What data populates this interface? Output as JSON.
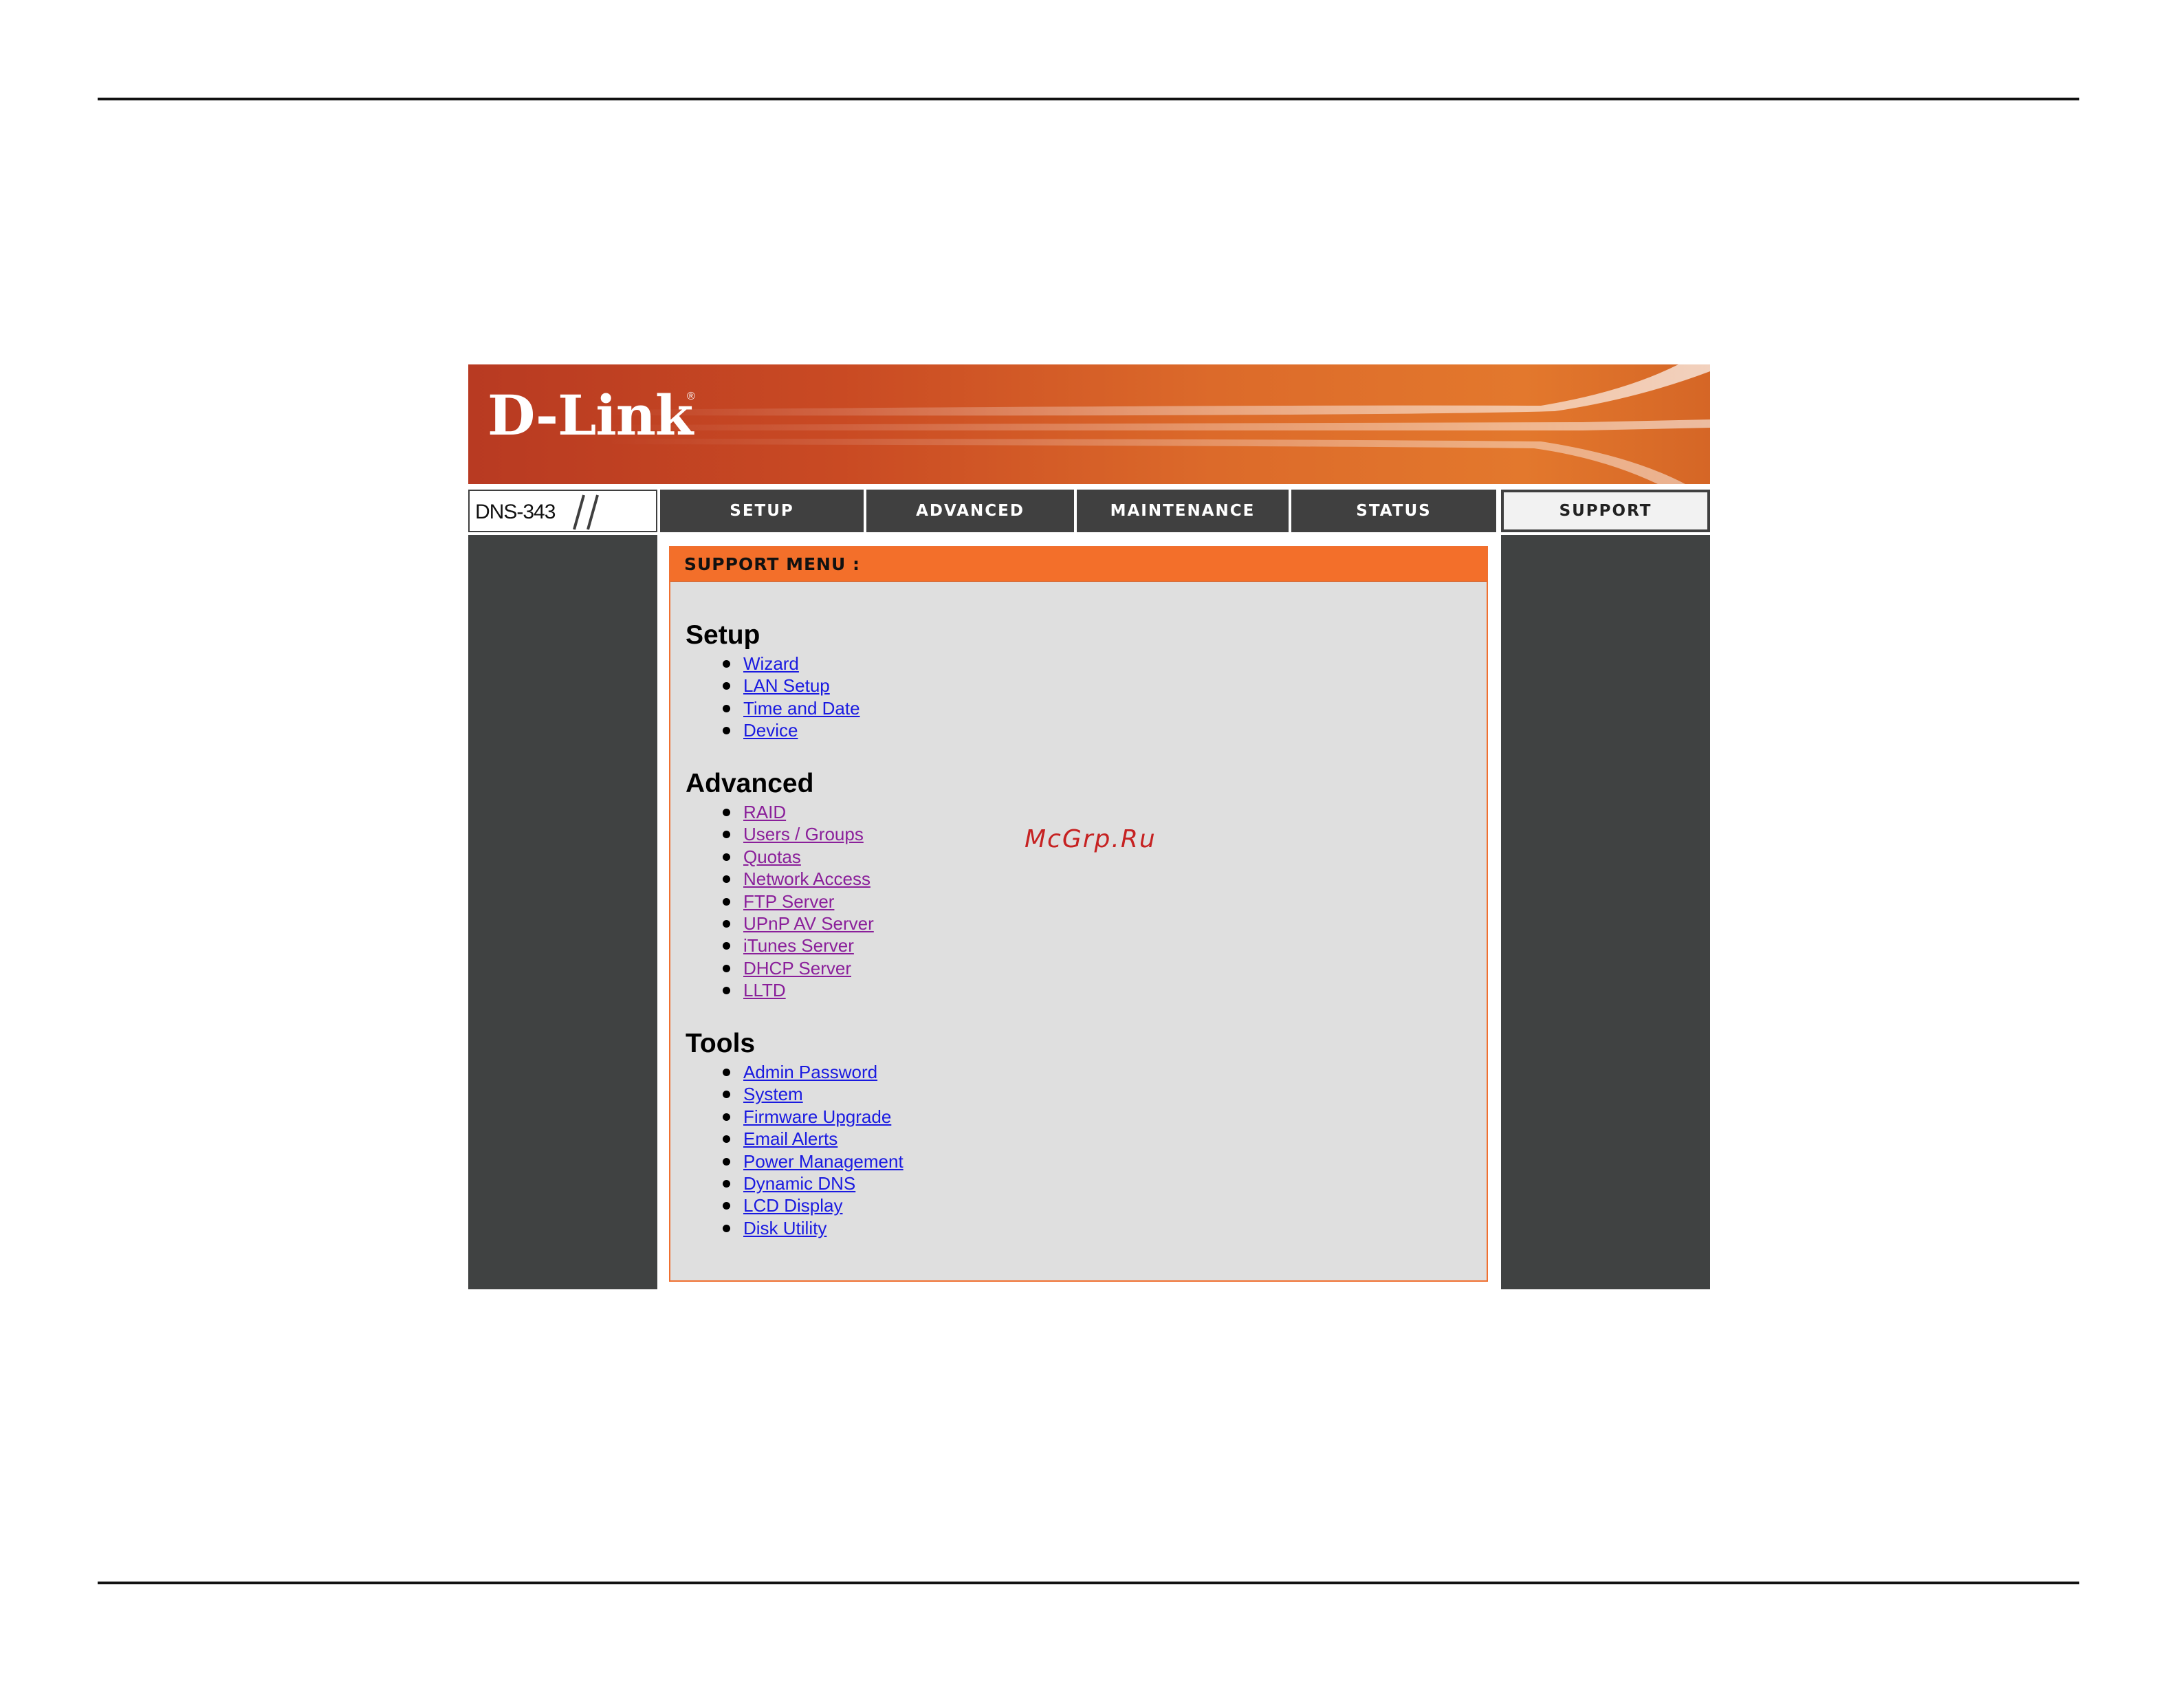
{
  "brand": {
    "logo_text": "D-Link",
    "registered_mark": "®",
    "model": "DNS-343"
  },
  "nav": {
    "tabs": [
      {
        "label": "SETUP",
        "active": false
      },
      {
        "label": "ADVANCED",
        "active": false
      },
      {
        "label": "MAINTENANCE",
        "active": false
      },
      {
        "label": "STATUS",
        "active": false
      },
      {
        "label": "SUPPORT",
        "active": true
      }
    ]
  },
  "panel": {
    "title": "SUPPORT MENU :",
    "sections": [
      {
        "title": "Setup",
        "link_color": "blue",
        "links": [
          "Wizard",
          "LAN Setup",
          "Time and Date",
          "Device"
        ]
      },
      {
        "title": "Advanced",
        "link_color": "purple",
        "links": [
          "RAID",
          "Users / Groups",
          "Quotas",
          "Network Access",
          "FTP Server",
          "UPnP AV Server",
          "iTunes Server",
          "DHCP Server",
          "LLTD"
        ]
      },
      {
        "title": "Tools",
        "link_color": "blue",
        "links": [
          "Admin Password",
          "System",
          "Firmware Upgrade",
          "Email Alerts",
          "Power Management",
          "Dynamic DNS",
          "LCD Display",
          "Disk Utility"
        ]
      }
    ]
  },
  "watermark": "McGrp.Ru",
  "colors": {
    "banner_orange": "#dc6a2a",
    "panel_header": "#f36f2a",
    "sidebar_gray": "#404242",
    "tab_dark": "#404040",
    "link_blue": "#1a1ae0",
    "link_visited": "#8a1f9a"
  }
}
